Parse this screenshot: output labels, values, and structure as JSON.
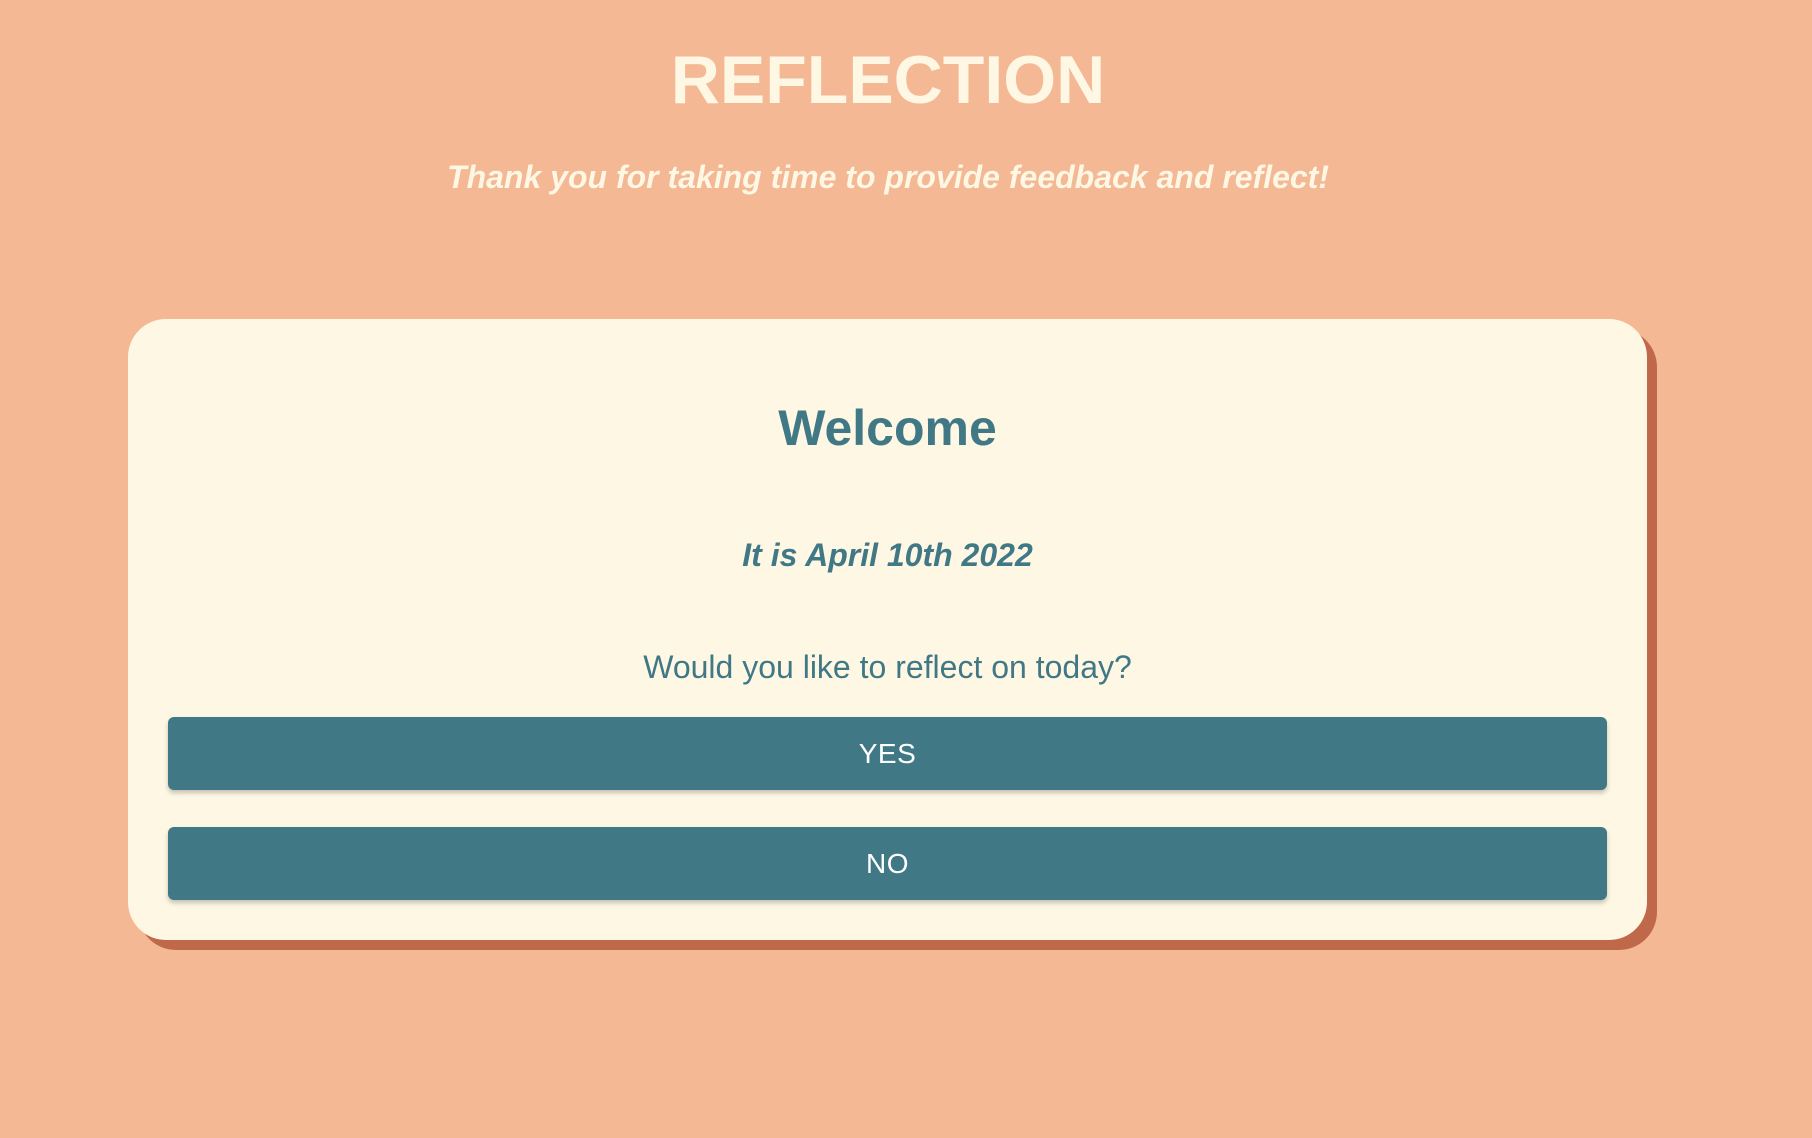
{
  "header": {
    "title": "REFLECTION",
    "subtitle": "Thank you for taking time to provide feedback and reflect!"
  },
  "card": {
    "heading": "Welcome",
    "date_text": "It is April 10th 2022",
    "question": "Would you like to reflect on today?",
    "yes_label": "YES",
    "no_label": "NO"
  },
  "colors": {
    "background": "#f4b894",
    "card": "#fdf7e4",
    "card_shadow": "#c0694a",
    "accent": "#417886",
    "header_text": "#fdf7e4"
  }
}
